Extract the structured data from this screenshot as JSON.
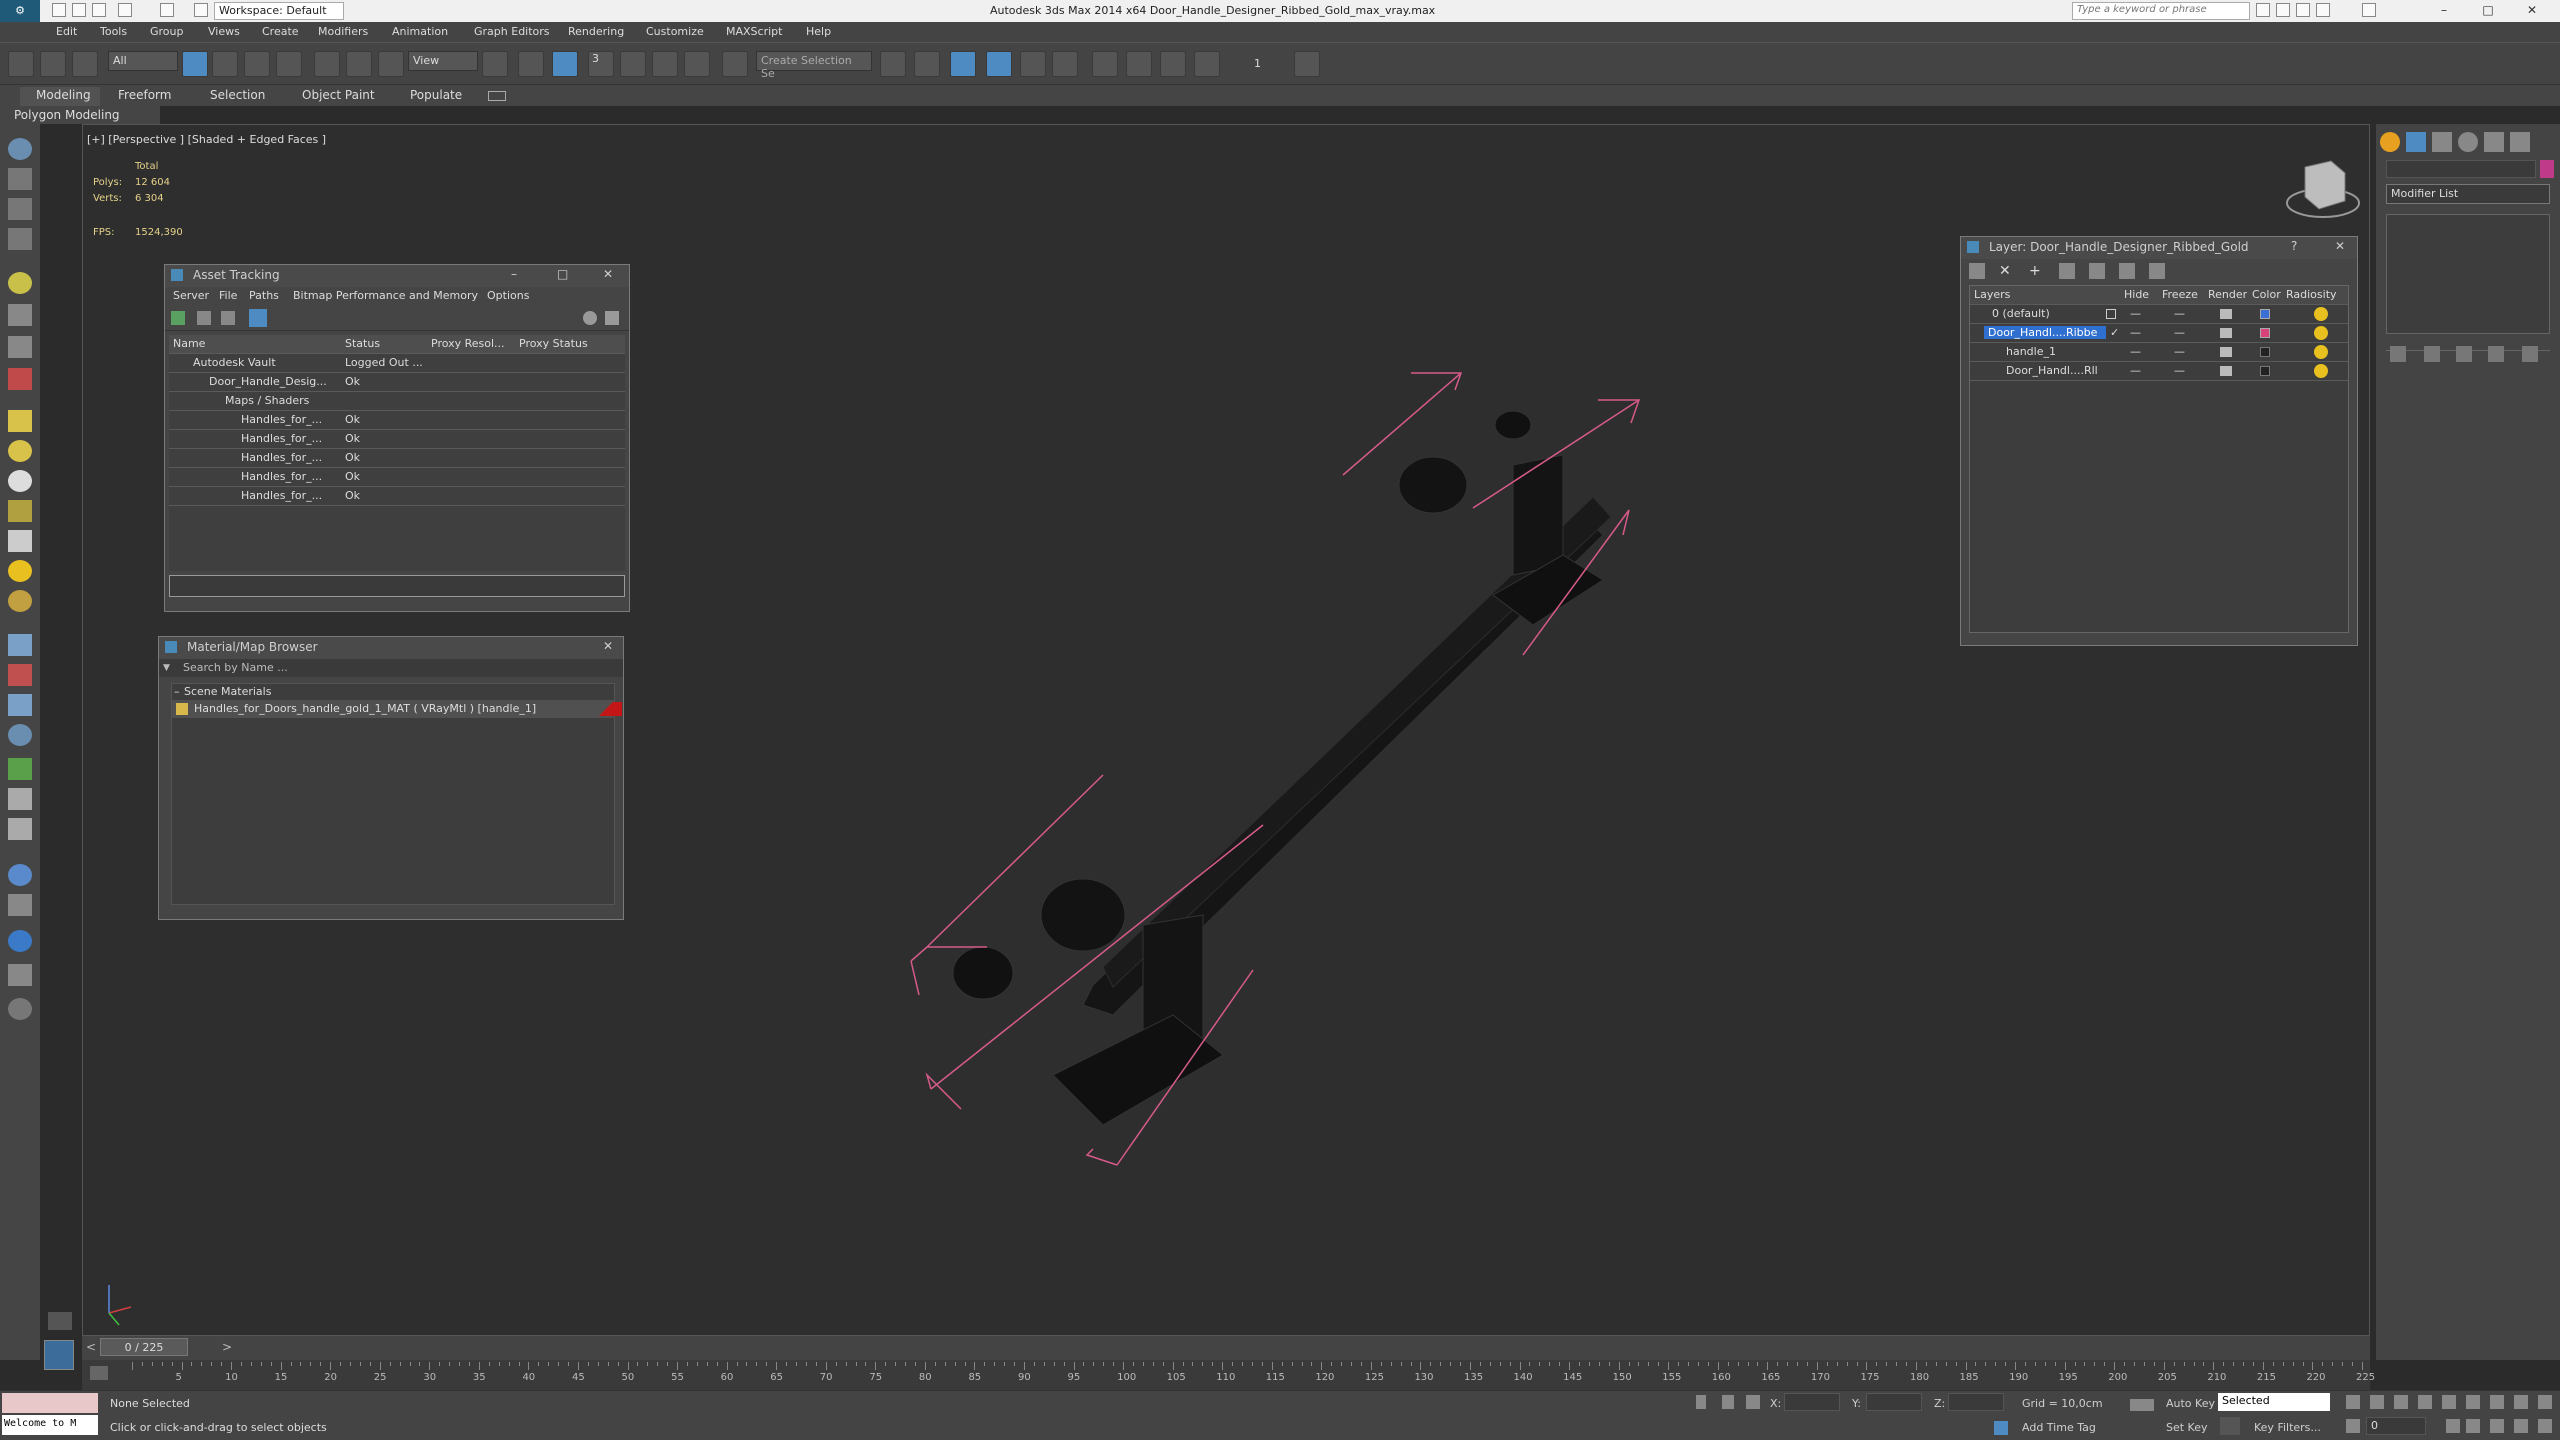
{
  "titlebar": {
    "workspace": "Workspace: Default",
    "title": "Autodesk 3ds Max  2014 x64     Door_Handle_Designer_Ribbed_Gold_max_vray.max",
    "search_placeholder": "Type a keyword or phrase"
  },
  "menu": [
    "Edit",
    "Tools",
    "Group",
    "Views",
    "Create",
    "Modifiers",
    "Animation",
    "Graph Editors",
    "Rendering",
    "Customize",
    "MAXScript",
    "Help"
  ],
  "toolbar": {
    "filter_value": "All",
    "refcoord_value": "View",
    "named_selection_placeholder": "Create Selection Se",
    "snap_label": "3",
    "spinner_label": "1"
  },
  "ribbon": {
    "tabs": [
      "Modeling",
      "Freeform",
      "Selection",
      "Object Paint",
      "Populate"
    ],
    "active_tab": "Modeling",
    "sub_label": "Polygon Modeling"
  },
  "viewport": {
    "label": "[+] [Perspective ] [Shaded + Edged Faces ]",
    "stats_total": "Total",
    "polys_label": "Polys:",
    "polys_value": "12 604",
    "verts_label": "Verts:",
    "verts_value": "6 304",
    "fps_label": "FPS:",
    "fps_value": "1524,390"
  },
  "asset_tracking": {
    "title": "Asset Tracking",
    "menu": [
      "Server",
      "File",
      "Paths",
      "Bitmap Performance and Memory",
      "Options"
    ],
    "columns": [
      "Name",
      "Status",
      "Proxy Resol...",
      "Proxy Status"
    ],
    "rows": [
      {
        "name": "Autodesk Vault",
        "status": "Logged Out ..."
      },
      {
        "name": "Door_Handle_Desig...",
        "status": "Ok"
      },
      {
        "name": "Maps / Shaders",
        "status": ""
      },
      {
        "name": "Handles_for_...",
        "status": "Ok"
      },
      {
        "name": "Handles_for_...",
        "status": "Ok"
      },
      {
        "name": "Handles_for_...",
        "status": "Ok"
      },
      {
        "name": "Handles_for_...",
        "status": "Ok"
      },
      {
        "name": "Handles_for_...",
        "status": "Ok"
      }
    ]
  },
  "material_browser": {
    "title": "Material/Map Browser",
    "search_placeholder": "Search by Name ...",
    "section": "Scene Materials",
    "item": "Handles_for_Doors_handle_gold_1_MAT ( VRayMtl ) [handle_1]"
  },
  "layer_manager": {
    "title": "Layer: Door_Handle_Designer_Ribbed_Gold",
    "columns": [
      "Layers",
      "Hide",
      "Freeze",
      "Render",
      "Color",
      "Radiosity"
    ],
    "rows": [
      {
        "name": "0 (default)",
        "color": "#3b6fd6"
      },
      {
        "name": "Door_Handl....Ribbe",
        "color": "#d8437a"
      },
      {
        "name": "handle_1",
        "color": "#222222"
      },
      {
        "name": "Door_Handl....Rll",
        "color": "#222222"
      }
    ]
  },
  "command_panel": {
    "modifier_list": "Modifier List"
  },
  "timeline": {
    "frame": "0 / 225",
    "ticks": [
      "5",
      "10",
      "15",
      "20",
      "25",
      "30",
      "35",
      "40",
      "45",
      "50",
      "55",
      "60",
      "65",
      "70",
      "75",
      "80",
      "85",
      "90",
      "95",
      "100",
      "105",
      "110",
      "115",
      "120",
      "125",
      "130",
      "135",
      "140",
      "145",
      "150",
      "155",
      "160",
      "165",
      "170",
      "175",
      "180",
      "185",
      "190",
      "195",
      "200",
      "205",
      "210",
      "215",
      "220",
      "225"
    ]
  },
  "status": {
    "maxscript": "Welcome to M",
    "selection": "None Selected",
    "prompt": "Click or click-and-drag to select objects",
    "x_label": "X:",
    "y_label": "Y:",
    "z_label": "Z:",
    "grid": "Grid = 10,0cm",
    "add_time_tag": "Add Time Tag",
    "auto_key": "Auto Key",
    "set_key": "Set Key",
    "selected_value": "Selected",
    "key_filters": "Key Filters...",
    "frame_value": "0"
  }
}
